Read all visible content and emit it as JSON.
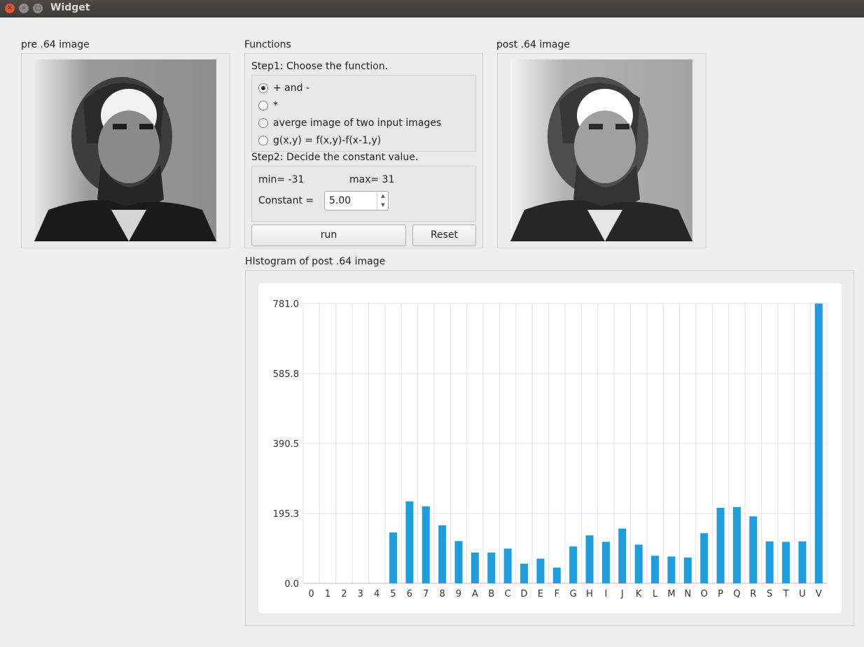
{
  "window": {
    "title": "Widget"
  },
  "pre_image": {
    "label": "pre .64 image"
  },
  "post_image": {
    "label": "post .64 image"
  },
  "functions": {
    "group_label": "Functions",
    "step1": "Step1: Choose the function.",
    "options": [
      {
        "label": "+ and -",
        "checked": true
      },
      {
        "label": "*",
        "checked": false
      },
      {
        "label": "averge image of two input images",
        "checked": false
      },
      {
        "label": "g(x,y) = f(x,y)-f(x-1,y)",
        "checked": false
      }
    ],
    "step2": "Step2: Decide the constant value.",
    "min_text": "min= -31",
    "max_text": "max= 31",
    "constant_label": "Constant =",
    "constant_value": "5.00",
    "run_label": "run",
    "reset_label": "Reset"
  },
  "histogram": {
    "label": "HIstogram of post .64 image"
  },
  "chart_data": {
    "type": "bar",
    "title": "",
    "xlabel": "",
    "ylabel": "",
    "categories": [
      "0",
      "1",
      "2",
      "3",
      "4",
      "5",
      "6",
      "7",
      "8",
      "9",
      "A",
      "B",
      "C",
      "D",
      "E",
      "F",
      "G",
      "H",
      "I",
      "J",
      "K",
      "L",
      "M",
      "N",
      "O",
      "P",
      "Q",
      "R",
      "S",
      "T",
      "U",
      "V"
    ],
    "values": [
      0,
      0,
      0,
      0,
      0,
      142,
      229,
      215,
      162,
      118,
      86,
      86,
      97,
      55,
      69,
      44,
      103,
      134,
      116,
      153,
      108,
      77,
      75,
      72,
      140,
      211,
      213,
      187,
      117,
      116,
      117,
      781
    ],
    "yticks": [
      "0.0",
      "195.3",
      "390.5",
      "585.8",
      "781.0"
    ],
    "ylim": [
      0,
      781
    ],
    "grid": true,
    "bar_color": "#1f9ede"
  }
}
